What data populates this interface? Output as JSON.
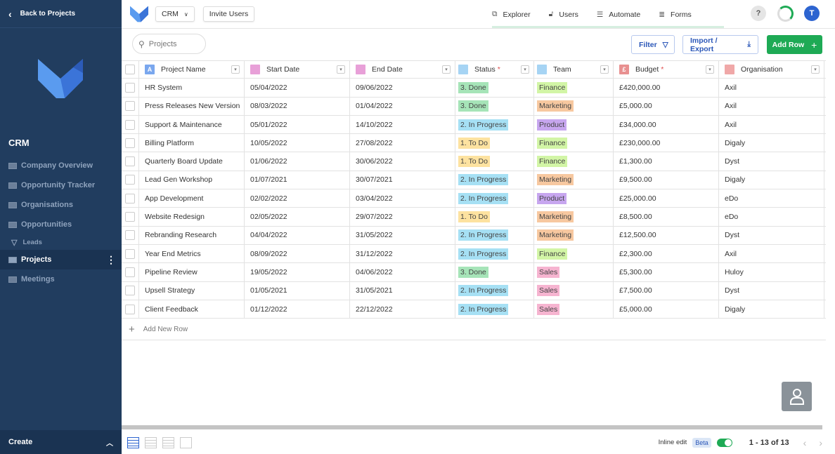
{
  "sidebar": {
    "back": "Back to Projects",
    "app_title": "CRM",
    "items": [
      {
        "label": "Company Overview",
        "icon": "dashboard-icon"
      },
      {
        "label": "Opportunity Tracker",
        "icon": "kanban-icon"
      },
      {
        "label": "Organisations",
        "icon": "table-icon"
      },
      {
        "label": "Opportunities",
        "icon": "table-icon"
      },
      {
        "label": "Leads",
        "icon": "filter-icon"
      },
      {
        "label": "Projects",
        "icon": "table-icon",
        "active": true
      },
      {
        "label": "Meetings",
        "icon": "table-icon"
      }
    ],
    "create": "Create"
  },
  "topbar": {
    "app_select": "CRM",
    "invite": "Invite Users",
    "nav": [
      "Explorer",
      "Users",
      "Automate",
      "Forms"
    ],
    "help": "?",
    "avatar": "T"
  },
  "toolbar": {
    "search_placeholder": "Projects",
    "filter": "Filter",
    "import_export": "Import / Export",
    "add_row": "Add Row"
  },
  "columns": [
    {
      "label": "Project Name",
      "icon": "A",
      "required": false
    },
    {
      "label": "Start Date",
      "required": false
    },
    {
      "label": "End Date",
      "required": false
    },
    {
      "label": "Status",
      "required": true
    },
    {
      "label": "Team",
      "required": false
    },
    {
      "label": "Budget",
      "icon": "£",
      "required": true
    },
    {
      "label": "Organisation",
      "required": false
    }
  ],
  "rows": [
    [
      "HR System",
      "05/04/2022",
      "09/06/2022",
      "3. Done",
      "Finance",
      "£420,000.00",
      "Axil"
    ],
    [
      "Press Releases New Version",
      "08/03/2022",
      "01/04/2022",
      "3. Done",
      "Marketing",
      "£5,000.00",
      "Axil"
    ],
    [
      "Support & Maintenance",
      "05/01/2022",
      "14/10/2022",
      "2. In Progress",
      "Product",
      "£34,000.00",
      "Axil"
    ],
    [
      "Billing Platform",
      "10/05/2022",
      "27/08/2022",
      "1. To Do",
      "Finance",
      "£230,000.00",
      "Digaly"
    ],
    [
      "Quarterly Board Update",
      "01/06/2022",
      "30/06/2022",
      "1. To Do",
      "Finance",
      "£1,300.00",
      "Dyst"
    ],
    [
      "Lead Gen Workshop",
      "01/07/2021",
      "30/07/2021",
      "2. In Progress",
      "Marketing",
      "£9,500.00",
      "Digaly"
    ],
    [
      "App Development",
      "02/02/2022",
      "03/04/2022",
      "2. In Progress",
      "Product",
      "£25,000.00",
      "eDo"
    ],
    [
      "Website Redesign",
      "02/05/2022",
      "29/07/2022",
      "1. To Do",
      "Marketing",
      "£8,500.00",
      "eDo"
    ],
    [
      "Rebranding Research",
      "04/04/2022",
      "31/05/2022",
      "2. In Progress",
      "Marketing",
      "£12,500.00",
      "Dyst"
    ],
    [
      "Year End Metrics",
      "08/09/2022",
      "31/12/2022",
      "2. In Progress",
      "Finance",
      "£2,300.00",
      "Axil"
    ],
    [
      "Pipeline Review",
      "19/05/2022",
      "04/06/2022",
      "3. Done",
      "Sales",
      "£5,300.00",
      "Huloy"
    ],
    [
      "Upsell Strategy",
      "01/05/2021",
      "31/05/2021",
      "2. In Progress",
      "Sales",
      "£7,500.00",
      "Dyst"
    ],
    [
      "Client Feedback",
      "01/12/2022",
      "22/12/2022",
      "2. In Progress",
      "Sales",
      "£5,000.00",
      "Digaly"
    ]
  ],
  "add_new_row": "Add New Row",
  "tag_colors": {
    "3. Done": "#a6e4b8",
    "2. In Progress": "#a6e0f4",
    "1. To Do": "#fde2a0",
    "Finance": "#d2f5a6",
    "Marketing": "#f7c8a0",
    "Product": "#c7a6ef",
    "Sales": "#f6b4d0"
  },
  "footer": {
    "inline_edit": "Inline edit",
    "beta": "Beta",
    "inline_edit_on": true,
    "pagination": "1 - 13 of 13"
  }
}
